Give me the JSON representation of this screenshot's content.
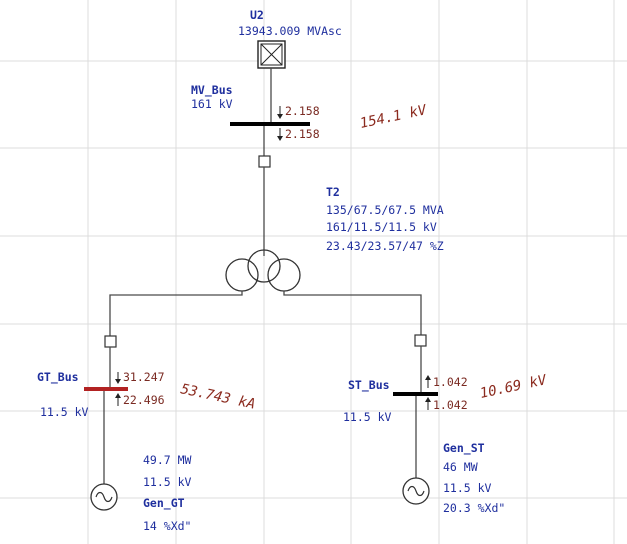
{
  "utility": {
    "name": "U2",
    "rating": "13943.009 MVAsc"
  },
  "mv_bus": {
    "name": "MV_Bus",
    "voltage": "161 kV",
    "flow_in": "2.158",
    "flow_out": "2.158",
    "result": "154.1 kV"
  },
  "transformer": {
    "name": "T2",
    "rating": "135/67.5/67.5 MVA",
    "voltages": "161/11.5/11.5 kV",
    "impedance": "23.43/23.57/47 %Z"
  },
  "gt_bus": {
    "name": "GT_Bus",
    "voltage": "11.5 kV",
    "flow_in": "31.247",
    "flow_out": "22.496",
    "result": "53.743 kA"
  },
  "st_bus": {
    "name": "ST_Bus",
    "voltage": "11.5 kV",
    "flow_in": "1.042",
    "flow_out": "1.042",
    "result": "10.69 kV"
  },
  "gen_gt": {
    "name": "Gen_GT",
    "power": "49.7 MW",
    "voltage": "11.5 kV",
    "reactance": "14 %Xd\""
  },
  "gen_st": {
    "name": "Gen_ST",
    "power": "46 MW",
    "voltage": "11.5 kV",
    "reactance": "20.3 %Xd\""
  },
  "colors": {
    "bus": "#000000",
    "faulted_bus": "#b22222",
    "label": "#1f2f9e",
    "result": "#8b2a1e",
    "wire": "#4a4a4a"
  }
}
